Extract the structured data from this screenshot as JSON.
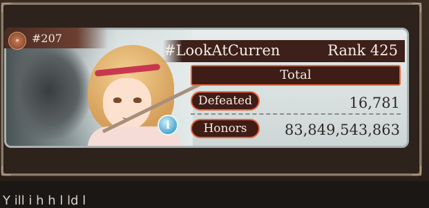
{
  "player": {
    "id": "#207",
    "name": "#LookAtCurren",
    "rank": "Rank 425"
  },
  "stats": {
    "header": "Total",
    "defeated_label": "Defeated",
    "defeated_value": "16,781",
    "honors_label": "Honors",
    "honors_value": "83,849,543,863"
  },
  "icons": {
    "emblem": "crew-emblem-icon",
    "info": "info-icon"
  },
  "colors": {
    "accent_border": "#e9643a",
    "label_bg": "#3f1d16",
    "card_bg": "#e8ecec"
  },
  "info_button_glyph": "i",
  "page_text": "Y             ill                 i            h  h  l                                 ld      l"
}
